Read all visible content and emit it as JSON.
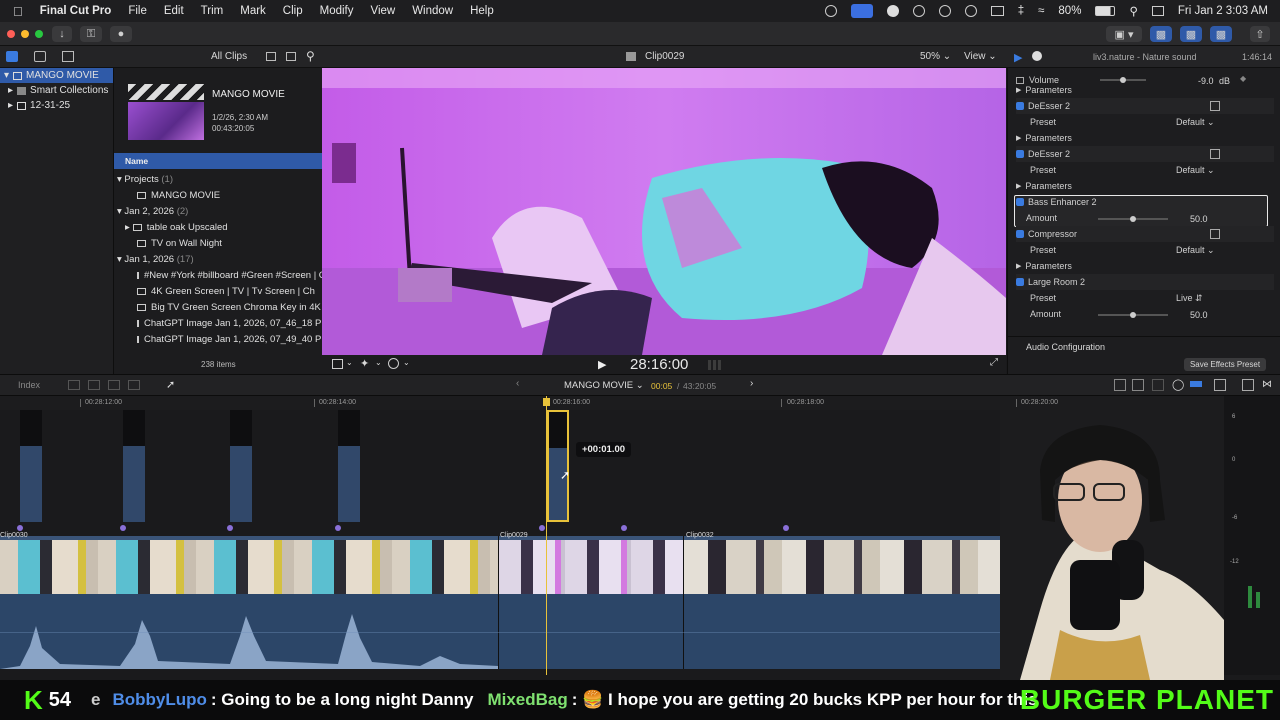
{
  "menubar": {
    "app": "Final Cut Pro",
    "items": [
      "File",
      "Edit",
      "Trim",
      "Mark",
      "Clip",
      "Modify",
      "View",
      "Window",
      "Help"
    ],
    "battery": "80%",
    "datetime": "Fri Jan 2  3:03 AM"
  },
  "browser": {
    "filter": "All Clips",
    "project_title": "MANGO MOVIE",
    "project_date": "1/2/26, 2:30 AM",
    "project_duration": "00:43:20:05",
    "column_name": "Name",
    "groups": [
      {
        "label": "Projects",
        "count": "(1)",
        "items": [
          "MANGO MOVIE"
        ]
      },
      {
        "label": "Jan 2, 2026",
        "count": "(2)",
        "items": [
          "table oak Upscaled",
          "TV on Wall Night"
        ]
      },
      {
        "label": "Jan 1, 2026",
        "count": "(17)",
        "items": [
          "#New #York #billboard #Green #Screen | C",
          "4K Green Screen | TV | Tv Screen | Ch",
          "Big TV Green Screen Chroma Key in 4K",
          "ChatGPT Image Jan 1, 2026, 07_46_18 PM",
          "ChatGPT Image Jan 1, 2026, 07_49_40 PM"
        ]
      }
    ],
    "item_count": "238 items"
  },
  "libraries": {
    "items": [
      "MANGO MOVIE",
      "Smart Collections",
      "12-31-25"
    ]
  },
  "viewer": {
    "clip_name": "Clip0029",
    "zoom": "50%",
    "view_label": "View",
    "timecode": "28:16:00"
  },
  "inspector": {
    "title": "liv3.nature - Nature sound",
    "duration": "1:46:14",
    "volume_label": "Volume",
    "volume_value": "-9.0",
    "volume_unit": "dB",
    "params_label": "Parameters",
    "effects": [
      {
        "name": "DeEsser 2",
        "preset_label": "Preset",
        "preset": "Default",
        "params": "Parameters"
      },
      {
        "name": "DeEsser 2",
        "preset_label": "Preset",
        "preset": "Default",
        "params": "Parameters"
      }
    ],
    "bass": {
      "name": "Bass Enhancer 2",
      "amount_label": "Amount",
      "amount": "50.0"
    },
    "compressor": {
      "name": "Compressor",
      "preset_label": "Preset",
      "preset": "Default",
      "params": "Parameters"
    },
    "large_room": {
      "name": "Large Room 2",
      "preset_label": "Preset",
      "preset": "Live",
      "amount_label": "Amount",
      "amount": "50.0"
    },
    "audio_config": "Audio Configuration",
    "save_preset": "Save Effects Preset"
  },
  "timeline": {
    "index_label": "Index",
    "project_name": "MANGO MOVIE",
    "position": "00:05",
    "total": "43:20:05",
    "ruler": [
      "00:28:12:00",
      "00:28:14:00",
      "00:28:16:00",
      "00:28:18:00",
      "00:28:20:00"
    ],
    "tooltip": "+00:01.00",
    "clips": [
      "Clip0030",
      "Clip0029",
      "Clip0032"
    ],
    "meter_marks": [
      "6",
      "0",
      "-6",
      "-12"
    ]
  },
  "ticker": {
    "kpp_count": "54",
    "user1": "BobbyLupo",
    "msg1": ": Going to be a long night Danny",
    "user2": "MixedBag",
    "msg2": ": 🍔 I hope you are getting 20 bucks KPP per hour for this",
    "brand": "BURGER PLANET"
  },
  "colors": {
    "accent": "#3a7be0",
    "playhead": "#e8c23a",
    "storyline": "#2c4668",
    "viewer_tint": "#b84fe0"
  }
}
